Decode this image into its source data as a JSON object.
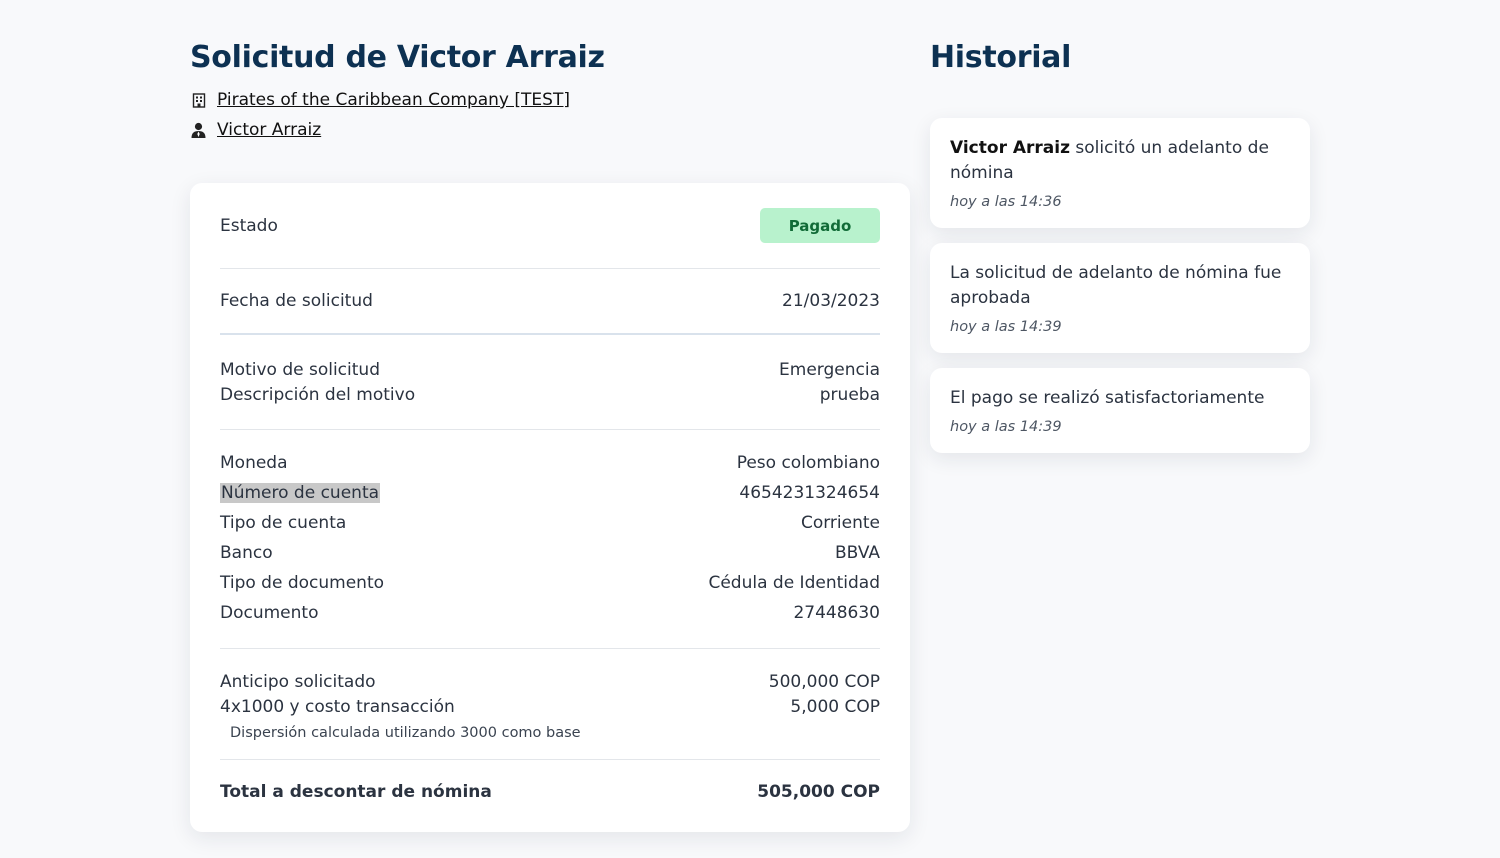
{
  "header": {
    "title": "Solicitud de Victor Arraiz",
    "company": "Pirates of the Caribbean Company [TEST]",
    "employee": "Victor Arraiz",
    "icons": {
      "company": "building-icon",
      "employee": "person-icon"
    }
  },
  "details": {
    "estado_label": "Estado",
    "estado_value": "Pagado",
    "fecha_label": "Fecha de solicitud",
    "fecha_value": "21/03/2023",
    "motivo_label": "Motivo de solicitud",
    "motivo_value": "Emergencia",
    "descripcion_label": "Descripción del motivo",
    "descripcion_value": "prueba",
    "moneda_label": "Moneda",
    "moneda_value": "Peso colombiano",
    "cuenta_label": "Número de cuenta",
    "cuenta_value": "4654231324654",
    "tipo_cuenta_label": "Tipo de cuenta",
    "tipo_cuenta_value": "Corriente",
    "banco_label": "Banco",
    "banco_value": "BBVA",
    "tipo_doc_label": "Tipo de documento",
    "tipo_doc_value": "Cédula de Identidad",
    "documento_label": "Documento",
    "documento_value": "27448630",
    "anticipo_label": "Anticipo solicitado",
    "anticipo_value": "500,000 COP",
    "costo_label": "4x1000 y costo transacción",
    "costo_value": "5,000 COP",
    "dispersion_note": "Dispersión calculada utilizando 3000 como base",
    "total_label": "Total a descontar de nómina",
    "total_value": "505,000 COP"
  },
  "historial": {
    "title": "Historial",
    "items": [
      {
        "actor": "Victor Arraiz",
        "text": " solicitó un adelanto de nómina",
        "time": "hoy a las 14:36"
      },
      {
        "actor": "",
        "text": "La solicitud de adelanto de nómina fue aprobada",
        "time": "hoy a las 14:39"
      },
      {
        "actor": "",
        "text": "El pago se realizó satisfactoriamente",
        "time": "hoy a las 14:39"
      }
    ]
  },
  "colors": {
    "title": "#0d3152",
    "badge_bg": "#b8f2cd",
    "badge_text": "#116b37",
    "page_bg": "#f8f9fb"
  }
}
